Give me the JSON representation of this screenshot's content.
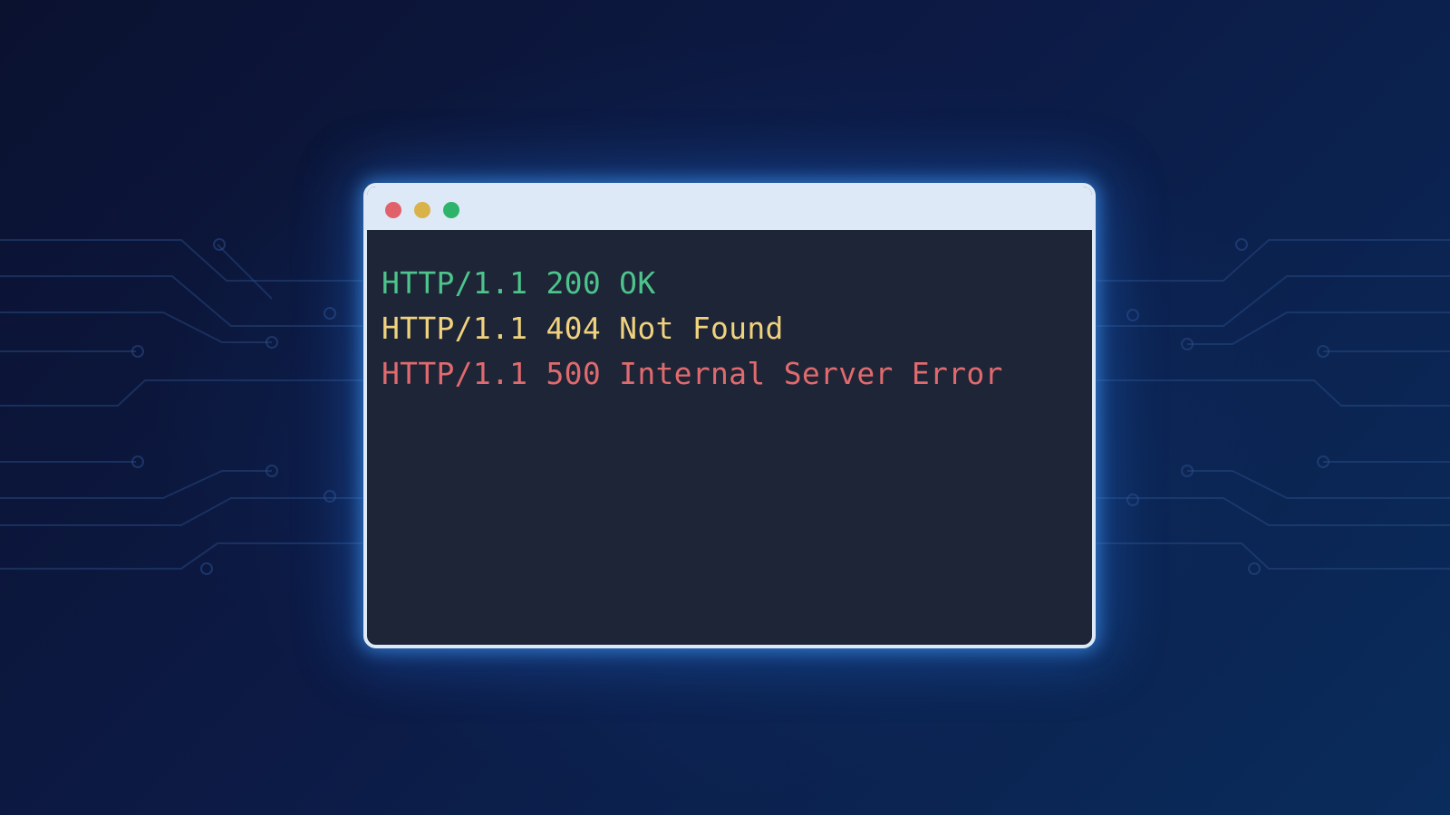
{
  "window": {
    "controls": [
      {
        "name": "close",
        "color": "#e1616b"
      },
      {
        "name": "minimize",
        "color": "#d9b24a"
      },
      {
        "name": "maximize",
        "color": "#2db36a"
      }
    ]
  },
  "terminal": {
    "lines": [
      {
        "text": "HTTP/1.1 200 OK",
        "color": "#4cc48b"
      },
      {
        "text": "HTTP/1.1 404 Not Found",
        "color": "#f0d27e"
      },
      {
        "text": "HTTP/1.1 500 Internal Server Error",
        "color": "#e06a6e"
      }
    ]
  },
  "colors": {
    "background_dark": "#0b1230",
    "background_light": "#0a2c5c",
    "window_frame": "#dde9f7",
    "terminal_bg": "#1d2536",
    "glow": "#46a0ff"
  }
}
